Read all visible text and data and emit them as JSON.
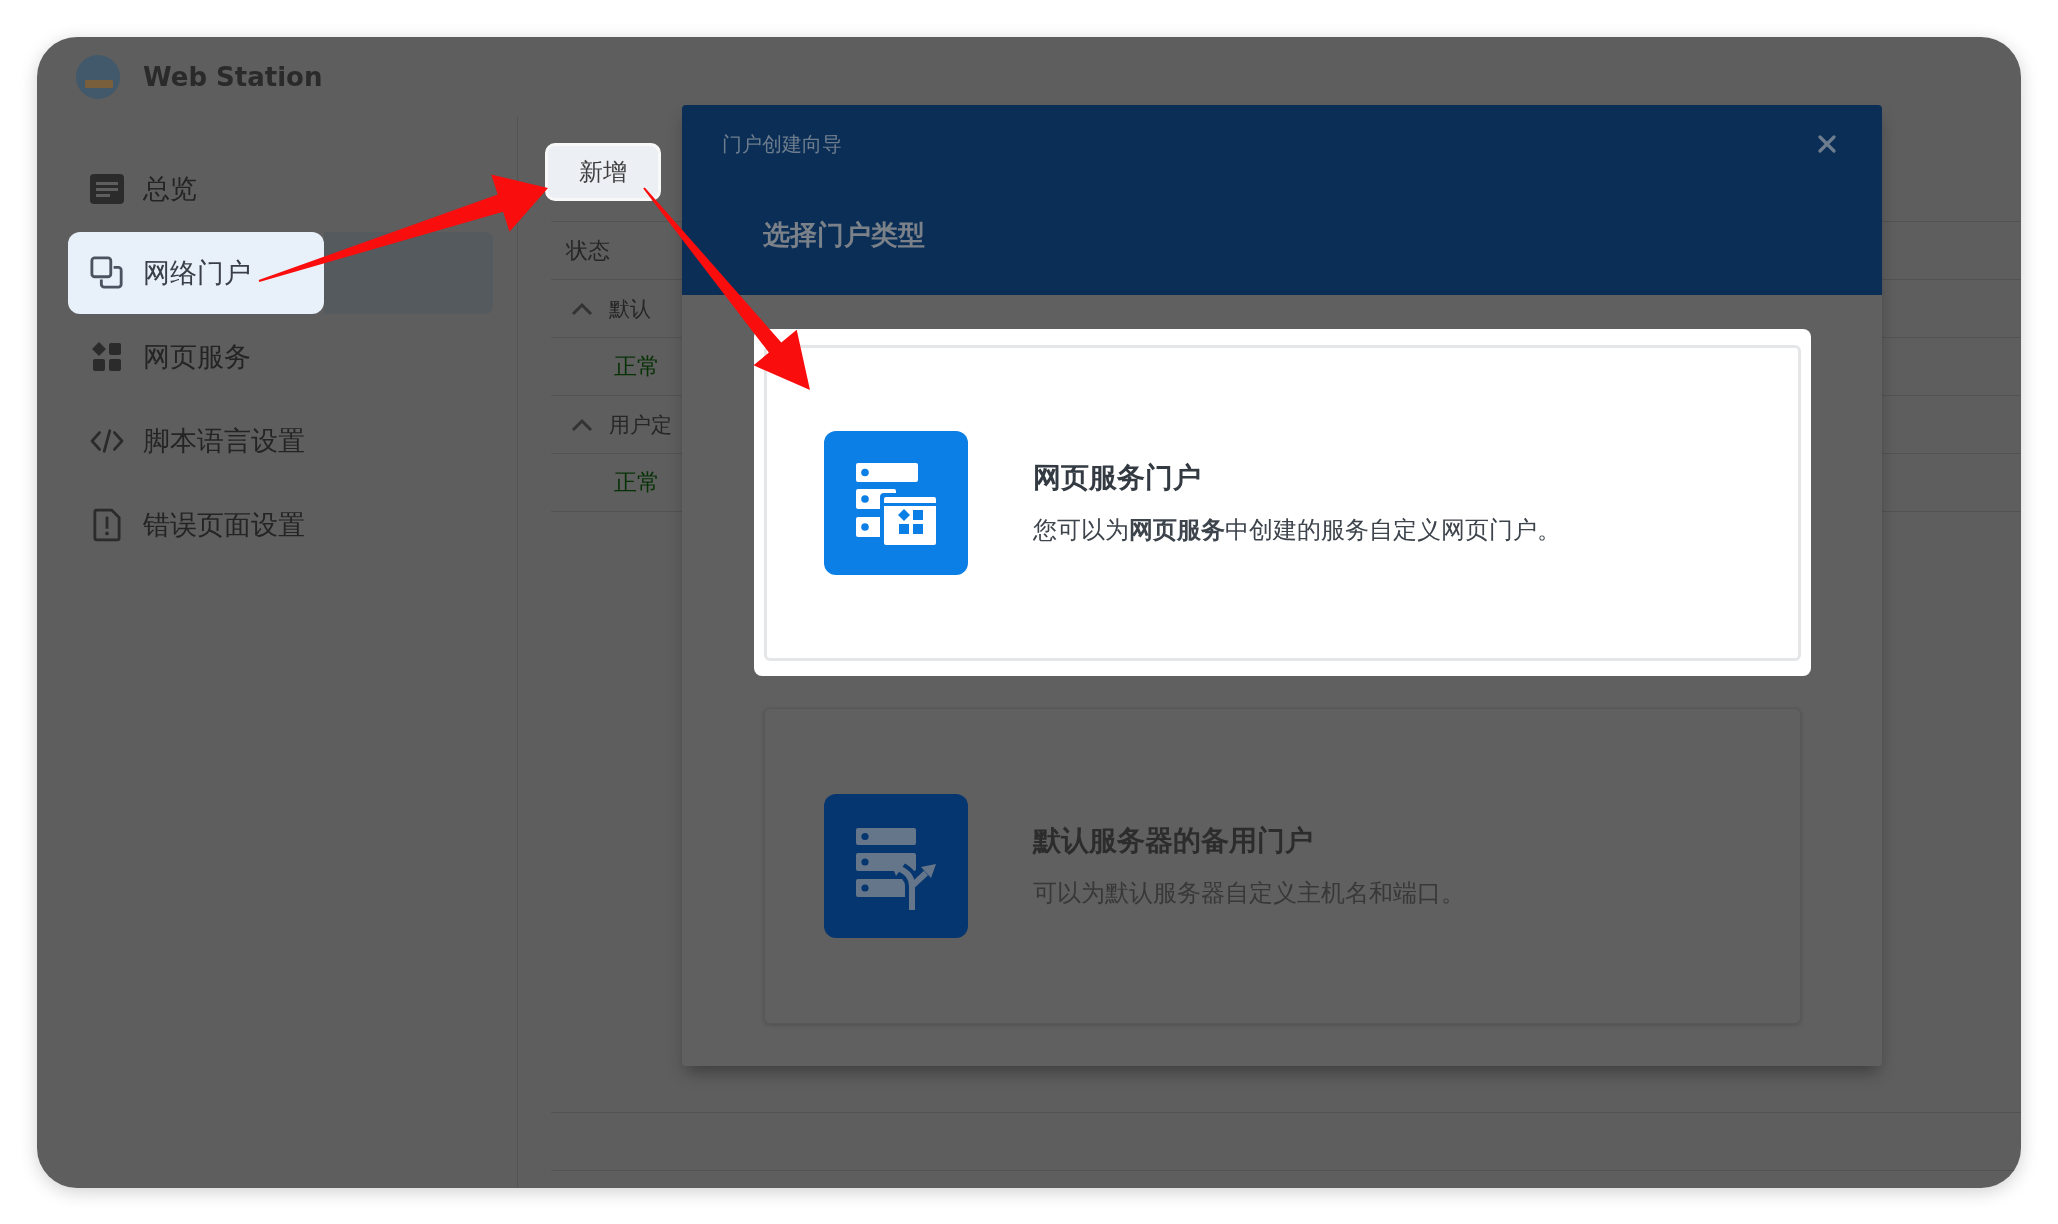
{
  "window": {
    "title": "Web Station"
  },
  "sidebar": {
    "items": [
      {
        "label": "总览",
        "selected": false
      },
      {
        "label": "网络门户",
        "selected": true
      },
      {
        "label": "网页服务",
        "selected": false
      },
      {
        "label": "脚本语言设置",
        "selected": false
      },
      {
        "label": "错误页面设置",
        "selected": false
      }
    ]
  },
  "toolbar": {
    "add_button": {
      "label": "新增",
      "highlighted": true
    }
  },
  "table": {
    "columns": [
      "状态"
    ],
    "groups": [
      {
        "label": "默认",
        "expanded": true,
        "rows": [
          {
            "status": "正常"
          }
        ]
      },
      {
        "label": "用户定",
        "expanded": true,
        "rows": [
          {
            "status": "正常"
          }
        ]
      }
    ]
  },
  "dialog": {
    "title": "门户创建向导",
    "heading": "选择门户类型",
    "options": [
      {
        "title": "网页服务门户",
        "description": "您可以为**网页服务**中创建的服务自定义网页门户。",
        "highlighted": true
      },
      {
        "title": "默认服务器的备用门户",
        "description": "可以为默认服务器自定义主机名和端口。",
        "highlighted": false
      }
    ]
  }
}
